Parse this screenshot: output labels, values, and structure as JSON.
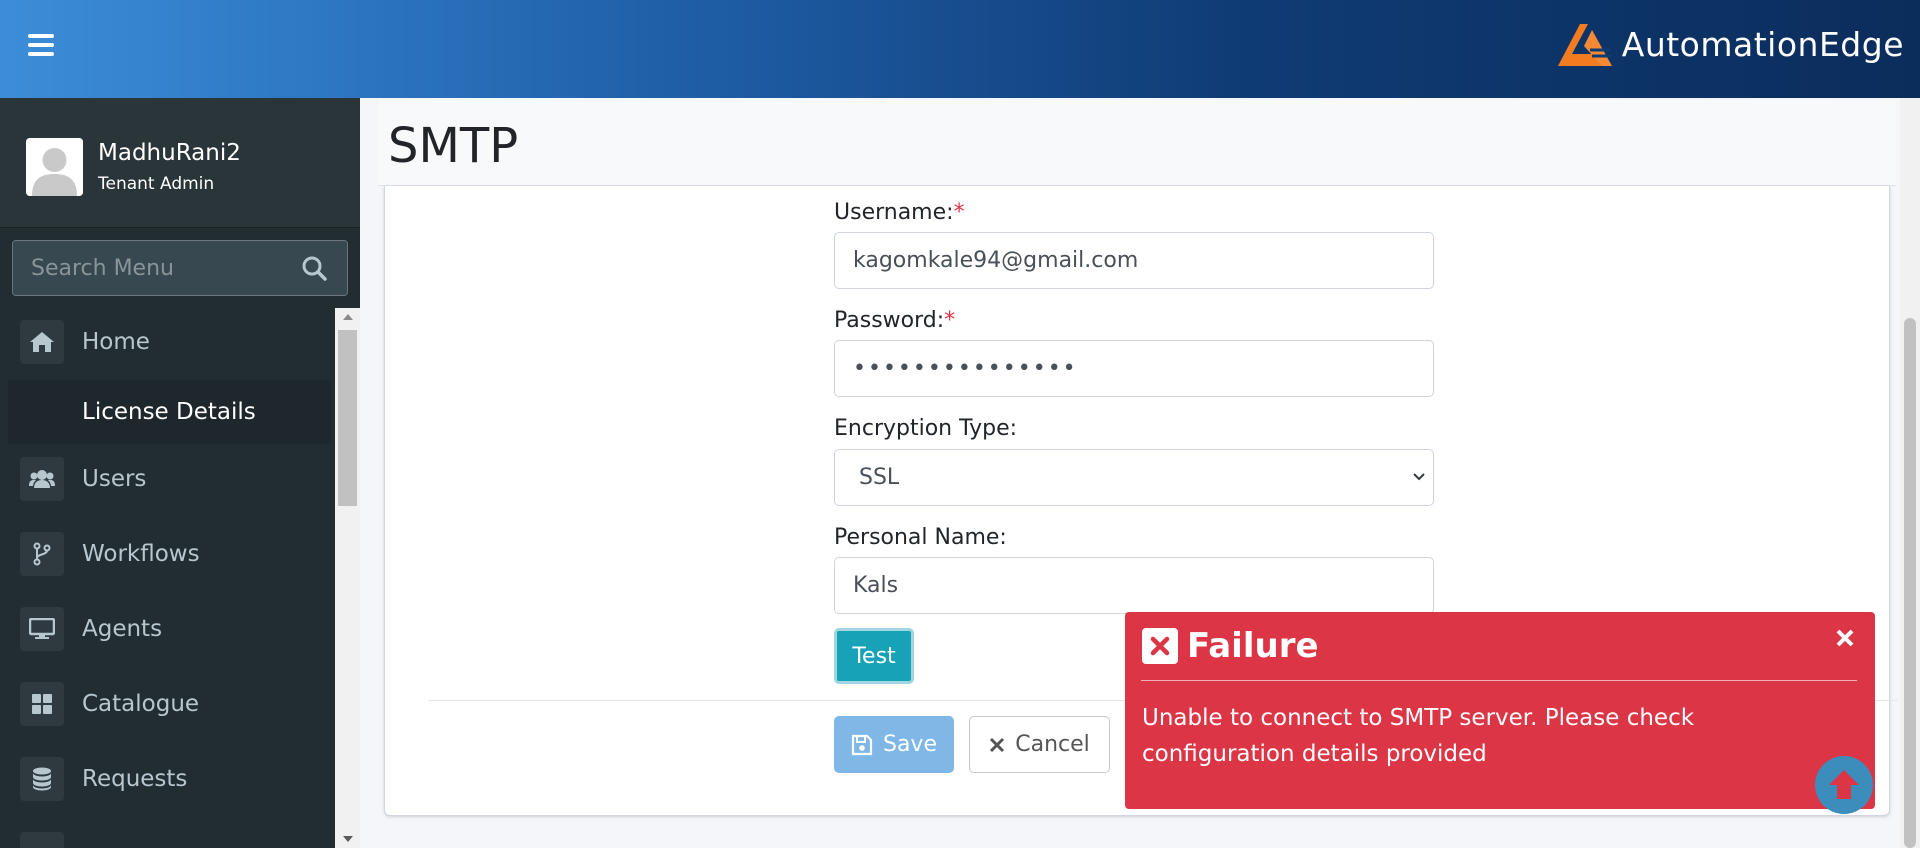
{
  "header": {
    "brand": "AutomationEdge",
    "colors": {
      "gradient_start": "#3c8dd9",
      "gradient_end": "#0b2d5c",
      "logo_orange": "#f47c20"
    }
  },
  "user": {
    "name": "MadhuRani2",
    "role": "Tenant Admin"
  },
  "search": {
    "placeholder": "Search Menu",
    "value": ""
  },
  "sidebar": {
    "items": [
      {
        "label": "Home",
        "icon": "home-icon"
      },
      {
        "label": "License Details",
        "icon": "",
        "active": true
      },
      {
        "label": "Users",
        "icon": "users-icon"
      },
      {
        "label": "Workflows",
        "icon": "code-branch-icon"
      },
      {
        "label": "Agents",
        "icon": "desktop-icon"
      },
      {
        "label": "Catalogue",
        "icon": "grid-icon"
      },
      {
        "label": "Requests",
        "icon": "database-icon"
      }
    ]
  },
  "page": {
    "title": "SMTP"
  },
  "form": {
    "username": {
      "label": "Username:",
      "required_mark": "*",
      "value": "kagomkale94@gmail.com"
    },
    "password": {
      "label": "Password:",
      "required_mark": "*",
      "value": "•••••••••••••••"
    },
    "encryption": {
      "label": "Encryption Type:",
      "value": "SSL"
    },
    "personal_name": {
      "label": "Personal Name:",
      "value": "Kals"
    },
    "test_label": "Test",
    "save_label": "Save",
    "cancel_label": "Cancel"
  },
  "toast": {
    "type": "error",
    "title": "Failure",
    "message": "Unable to connect to SMTP server. Please check configuration details provided",
    "color": "#dc3545"
  }
}
